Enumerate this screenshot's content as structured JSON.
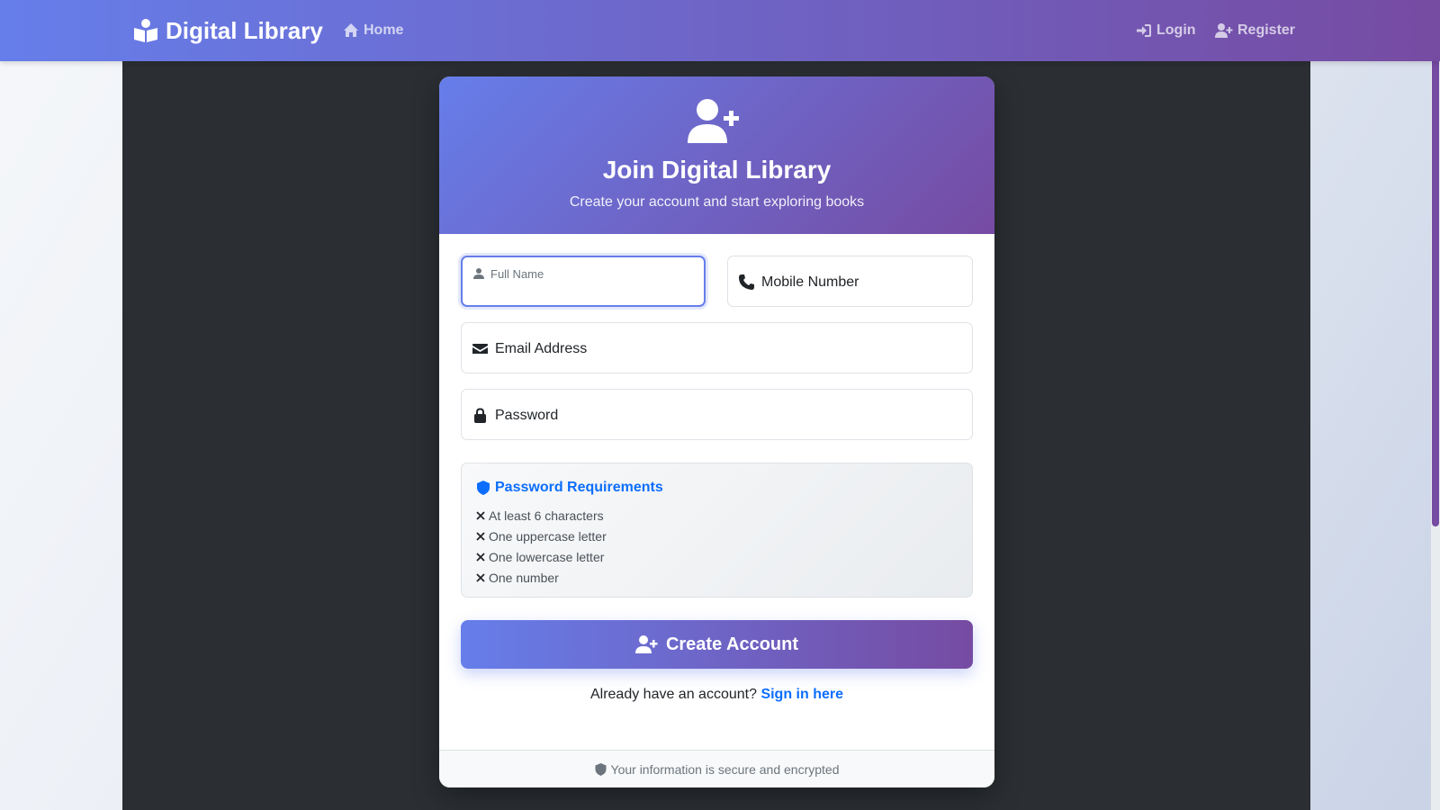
{
  "navbar": {
    "brand": "Digital Library",
    "home": "Home",
    "login": "Login",
    "register": "Register"
  },
  "card": {
    "title": "Join Digital Library",
    "subtitle": "Create your account and start exploring books"
  },
  "form": {
    "full_name_label": "Full Name",
    "mobile_label": "Mobile Number",
    "email_label": "Email Address",
    "password_label": "Password"
  },
  "requirements": {
    "title": "Password Requirements",
    "items": [
      "At least 6 characters",
      "One uppercase letter",
      "One lowercase letter",
      "One number"
    ]
  },
  "actions": {
    "create_account": "Create Account",
    "signin_prompt": "Already have an account?",
    "signin_link": "Sign in here"
  },
  "footer": {
    "secure_note": "Your information is secure and encrypted"
  },
  "colors": {
    "gradient_start": "#667eea",
    "gradient_end": "#764ba2",
    "link": "#0d6efd",
    "dark_bg": "#2b2f33"
  },
  "icons": {
    "brand": "book-reader-icon",
    "home": "home-icon",
    "login": "sign-in-icon",
    "register": "user-plus-icon",
    "full_name": "user-icon",
    "mobile": "phone-icon",
    "email": "envelope-icon",
    "password": "lock-icon",
    "requirements": "shield-icon",
    "requirement_status": "x-mark-icon"
  }
}
